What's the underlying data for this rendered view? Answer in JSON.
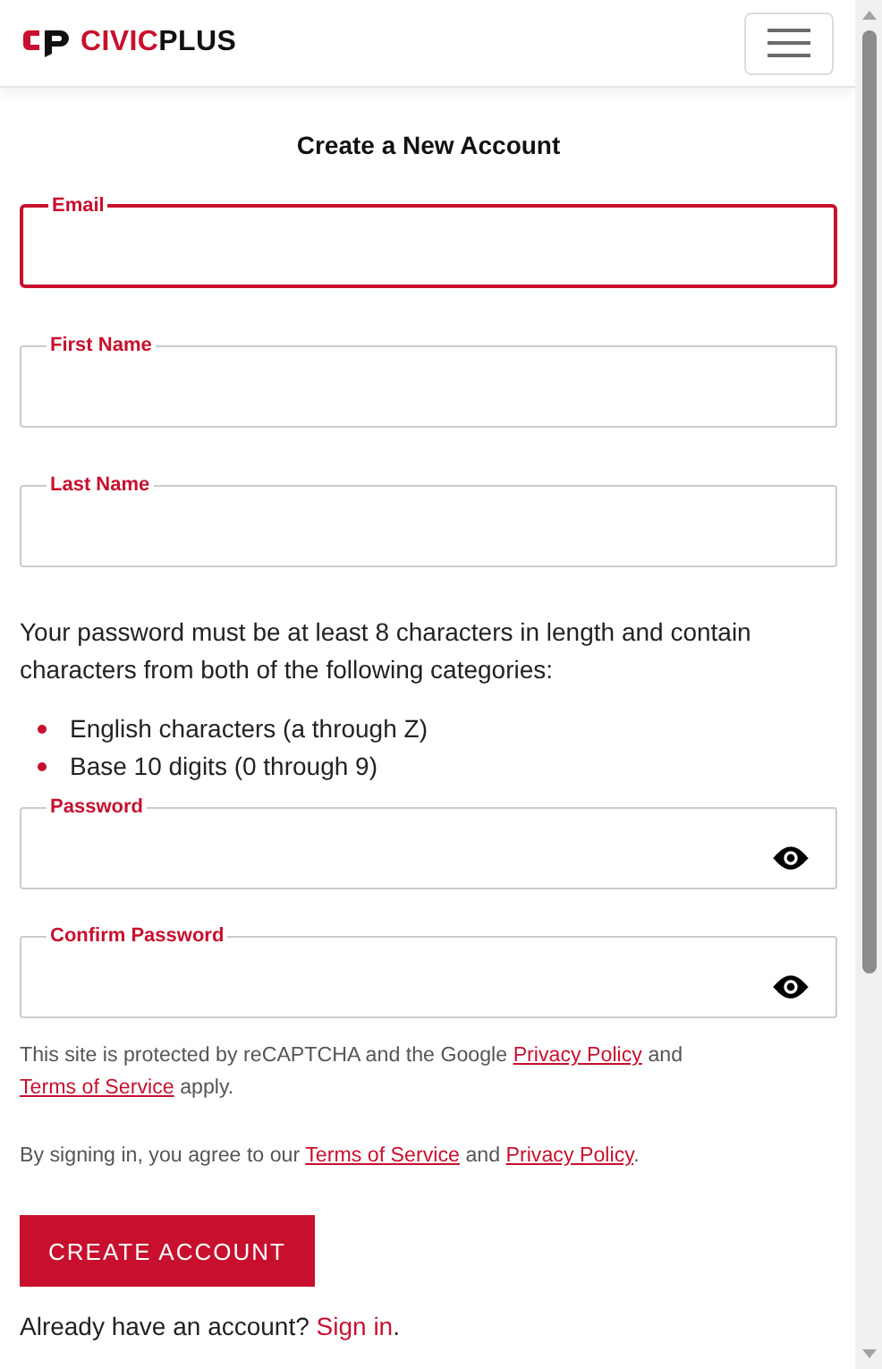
{
  "header": {
    "logo": {
      "part_1": "CIVIC",
      "part_2": "PLUS"
    }
  },
  "title": "Create a New Account",
  "fields": [
    {
      "label": "Email",
      "focused": true
    },
    {
      "label": "First Name",
      "focused": false
    },
    {
      "label": "Last Name",
      "focused": false
    }
  ],
  "password_rules": {
    "intro": "Your password must be at least 8 characters in length and contain characters from both of the following categories:",
    "items": [
      "English characters (a through Z)",
      "Base 10 digits (0 through 9)"
    ]
  },
  "password_fields": [
    {
      "label": "Password",
      "focused": false
    },
    {
      "label": "Confirm Password",
      "focused": false
    }
  ],
  "notices": [
    [
      {
        "text": "This site is protected by reCAPTCHA and the Google "
      },
      {
        "text": "Privacy Policy",
        "link": true
      },
      {
        "text": " and "
      },
      {
        "text": "Terms of Service",
        "link": true
      },
      {
        "text": " apply."
      }
    ],
    [
      {
        "text": "By signing in, you agree to our "
      },
      {
        "text": "Terms of Service",
        "link": true
      },
      {
        "text": " and "
      },
      {
        "text": "Privacy Policy",
        "link": true
      },
      {
        "text": "."
      }
    ]
  ],
  "submit_button": "CREATE ACCOUNT",
  "signin": [
    {
      "text": "Already have an account? "
    },
    {
      "text": "Sign in",
      "link": true
    },
    {
      "text": "."
    }
  ]
}
